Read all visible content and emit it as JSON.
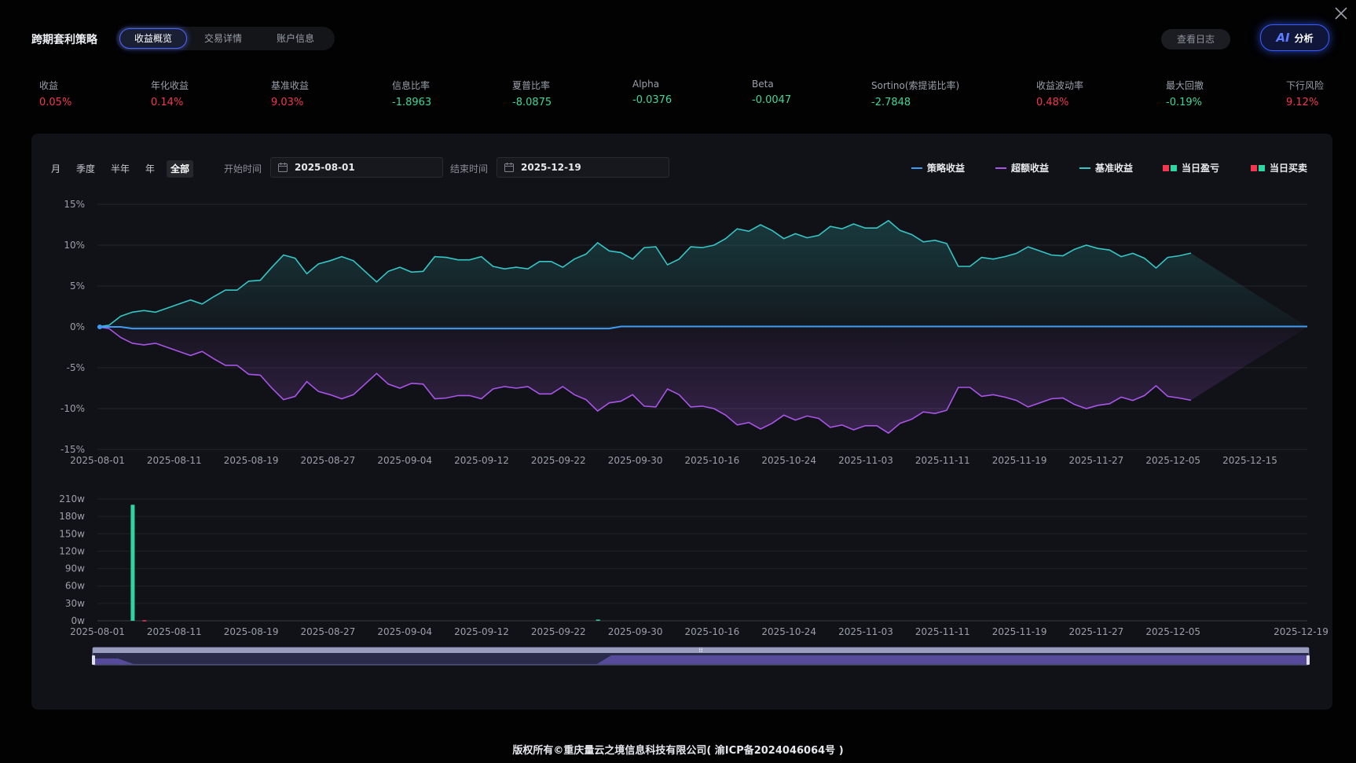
{
  "header": {
    "brand": "跨期套利策略",
    "tabs": [
      {
        "label": "收益概览",
        "active": true
      },
      {
        "label": "交易详情",
        "active": false
      },
      {
        "label": "账户信息",
        "active": false
      }
    ],
    "log_button": "查看日志",
    "ai_icon": "AI",
    "ai_label": "分析"
  },
  "metrics": [
    {
      "label": "收益",
      "value": "0.05%",
      "tone": "red"
    },
    {
      "label": "年化收益",
      "value": "0.14%",
      "tone": "red"
    },
    {
      "label": "基准收益",
      "value": "9.03%",
      "tone": "red"
    },
    {
      "label": "信息比率",
      "value": "-1.8963",
      "tone": "green"
    },
    {
      "label": "夏普比率",
      "value": "-8.0875",
      "tone": "green"
    },
    {
      "label": "Alpha",
      "value": "-0.0376",
      "tone": "green"
    },
    {
      "label": "Beta",
      "value": "-0.0047",
      "tone": "green"
    },
    {
      "label": "Sortino(索提诺比率)",
      "value": "-2.7848",
      "tone": "green"
    },
    {
      "label": "收益波动率",
      "value": "0.48%",
      "tone": "red"
    },
    {
      "label": "最大回撤",
      "value": "-0.19%",
      "tone": "green"
    },
    {
      "label": "下行风险",
      "value": "9.12%",
      "tone": "red"
    }
  ],
  "filters": {
    "periods": [
      {
        "label": "月",
        "active": false
      },
      {
        "label": "季度",
        "active": false
      },
      {
        "label": "半年",
        "active": false
      },
      {
        "label": "年",
        "active": false
      },
      {
        "label": "全部",
        "active": true
      }
    ],
    "start_label": "开始时间",
    "start_value": "2025-08-01",
    "end_label": "结束时间",
    "end_value": "2025-12-19"
  },
  "legend": [
    {
      "label": "策略收益",
      "kind": "line",
      "color": "#3d9df5"
    },
    {
      "label": "超额收益",
      "kind": "line",
      "color": "#a855e8"
    },
    {
      "label": "基准收益",
      "kind": "line",
      "color": "#35c6c6"
    },
    {
      "label": "当日盈亏",
      "kind": "squares",
      "colors": [
        "#f2384e",
        "#2fd5a0"
      ]
    },
    {
      "label": "当日买卖",
      "kind": "squares",
      "colors": [
        "#f2384e",
        "#2fd5a0"
      ]
    }
  ],
  "colors": {
    "strategy": "#3d9df5",
    "excess": "#a855e8",
    "benchmark": "#35c6c6",
    "loss": "#f2384e",
    "gain": "#2fd5a0"
  },
  "chart_data": [
    {
      "type": "line",
      "x_ticks": [
        "2025-08-01",
        "2025-08-11",
        "2025-08-19",
        "2025-08-27",
        "2025-09-04",
        "2025-09-12",
        "2025-09-22",
        "2025-09-30",
        "2025-10-16",
        "2025-10-24",
        "2025-11-03",
        "2025-11-11",
        "2025-11-19",
        "2025-11-27",
        "2025-12-05",
        "2025-12-15"
      ],
      "y_ticks": [
        "15%",
        "10%",
        "5%",
        "0%",
        "-5%",
        "-10%",
        "-15%"
      ],
      "ylim": [
        -15,
        15
      ],
      "series": [
        {
          "name": "策略收益",
          "values": [
            0,
            0,
            0,
            -0.2,
            -0.2,
            -0.2,
            -0.2,
            -0.2,
            -0.2,
            -0.2,
            -0.2,
            -0.2,
            -0.2,
            -0.2,
            -0.2,
            -0.2,
            -0.2,
            -0.2,
            -0.2,
            -0.2,
            -0.2,
            -0.2,
            -0.2,
            -0.2,
            -0.2,
            -0.2,
            -0.2,
            -0.2,
            -0.2,
            -0.2,
            -0.2,
            -0.2,
            -0.2,
            -0.2,
            -0.2,
            -0.2,
            -0.2,
            -0.2,
            -0.2,
            -0.2,
            -0.2,
            -0.2,
            -0.2,
            -0.2,
            -0.2,
            0.05,
            0.05,
            0.05,
            0.05,
            0.05,
            0.05,
            0.05,
            0.05,
            0.05,
            0.05,
            0.05,
            0.05,
            0.05,
            0.05,
            0.05,
            0.05,
            0.05,
            0.05,
            0.05,
            0.05,
            0.05,
            0.05,
            0.05,
            0.05,
            0.05,
            0.05,
            0.05,
            0.05,
            0.05,
            0.05,
            0.05,
            0.05,
            0.05,
            0.05,
            0.05,
            0.05,
            0.05,
            0.05,
            0.05,
            0.05,
            0.05,
            0.05,
            0.05,
            0.05,
            0.05,
            0.05,
            0.05,
            0.05,
            0.05,
            0.05,
            0.05,
            0.05,
            0.05,
            0.05,
            0.05,
            0.05,
            0.05,
            0.05,
            0.05,
            0.05
          ]
        },
        {
          "name": "基准收益",
          "values": [
            0,
            0.2,
            1.3,
            1.8,
            2,
            1.8,
            2.3,
            2.8,
            3.3,
            2.8,
            3.7,
            4.5,
            4.5,
            5.6,
            5.7,
            7.3,
            8.8,
            8.4,
            6.5,
            7.7,
            8.1,
            8.6,
            8.1,
            6.8,
            5.5,
            6.8,
            7.3,
            6.7,
            6.8,
            8.6,
            8.5,
            8.2,
            8.2,
            8.6,
            7.4,
            7.1,
            7.3,
            7.1,
            8,
            8,
            7.3,
            8.3,
            8.9,
            10.3,
            9.3,
            9.1,
            8.3,
            9.7,
            9.8,
            7.6,
            8.3,
            9.8,
            9.7,
            10,
            10.8,
            12,
            11.7,
            12.5,
            11.8,
            10.8,
            11.4,
            10.9,
            11.2,
            12.3,
            12,
            12.6,
            12.1,
            12.1,
            13,
            11.8,
            11.3,
            10.4,
            10.6,
            10.2,
            7.4,
            7.4,
            8.5,
            8.3,
            8.6,
            9,
            9.8,
            9.3,
            8.8,
            8.7,
            9.5,
            10,
            9.6,
            9.4,
            8.6,
            9,
            8.4,
            7.2,
            8.5,
            8.7,
            9.03
          ]
        },
        {
          "name": "超额收益",
          "values": [
            0,
            -0.2,
            -1.3,
            -2,
            -2.2,
            -2,
            -2.5,
            -3,
            -3.5,
            -3,
            -3.9,
            -4.7,
            -4.7,
            -5.8,
            -5.9,
            -7.5,
            -8.9,
            -8.5,
            -6.7,
            -7.9,
            -8.3,
            -8.8,
            -8.3,
            -7,
            -5.7,
            -7,
            -7.5,
            -6.9,
            -7,
            -8.8,
            -8.7,
            -8.4,
            -8.4,
            -8.8,
            -7.6,
            -7.3,
            -7.5,
            -7.3,
            -8.2,
            -8.2,
            -7.3,
            -8.3,
            -8.9,
            -10.3,
            -9.3,
            -9.1,
            -8.3,
            -9.7,
            -9.8,
            -7.6,
            -8.3,
            -9.8,
            -9.7,
            -10,
            -10.8,
            -12,
            -11.7,
            -12.5,
            -11.8,
            -10.8,
            -11.4,
            -10.9,
            -11.2,
            -12.3,
            -12,
            -12.6,
            -12.1,
            -12.1,
            -13,
            -11.8,
            -11.3,
            -10.4,
            -10.6,
            -10.2,
            -7.4,
            -7.4,
            -8.5,
            -8.3,
            -8.6,
            -9,
            -9.8,
            -9.3,
            -8.8,
            -8.7,
            -9.5,
            -10,
            -9.6,
            -9.4,
            -8.6,
            -9,
            -8.4,
            -7.2,
            -8.5,
            -8.7,
            -8.98
          ]
        }
      ]
    },
    {
      "type": "bar",
      "x_ticks": [
        "2025-08-01",
        "2025-08-11",
        "2025-08-19",
        "2025-08-27",
        "2025-09-04",
        "2025-09-12",
        "2025-09-22",
        "2025-09-30",
        "2025-10-16",
        "2025-10-24",
        "2025-11-03",
        "2025-11-11",
        "2025-11-19",
        "2025-11-27",
        "2025-12-05",
        "2025-12-19"
      ],
      "y_ticks": [
        "210w",
        "180w",
        "150w",
        "120w",
        "90w",
        "60w",
        "30w",
        "0w"
      ],
      "ylim": [
        0,
        210
      ],
      "bars": [
        {
          "index": 3,
          "value": 200,
          "tone": "gain"
        },
        {
          "index": 4,
          "value": 1,
          "tone": "loss"
        },
        {
          "index": 43,
          "value": 2,
          "tone": "gain"
        }
      ]
    }
  ],
  "footer": "版权所有©重庆量云之境信息科技有限公司( 渝ICP备2024046064号 )"
}
